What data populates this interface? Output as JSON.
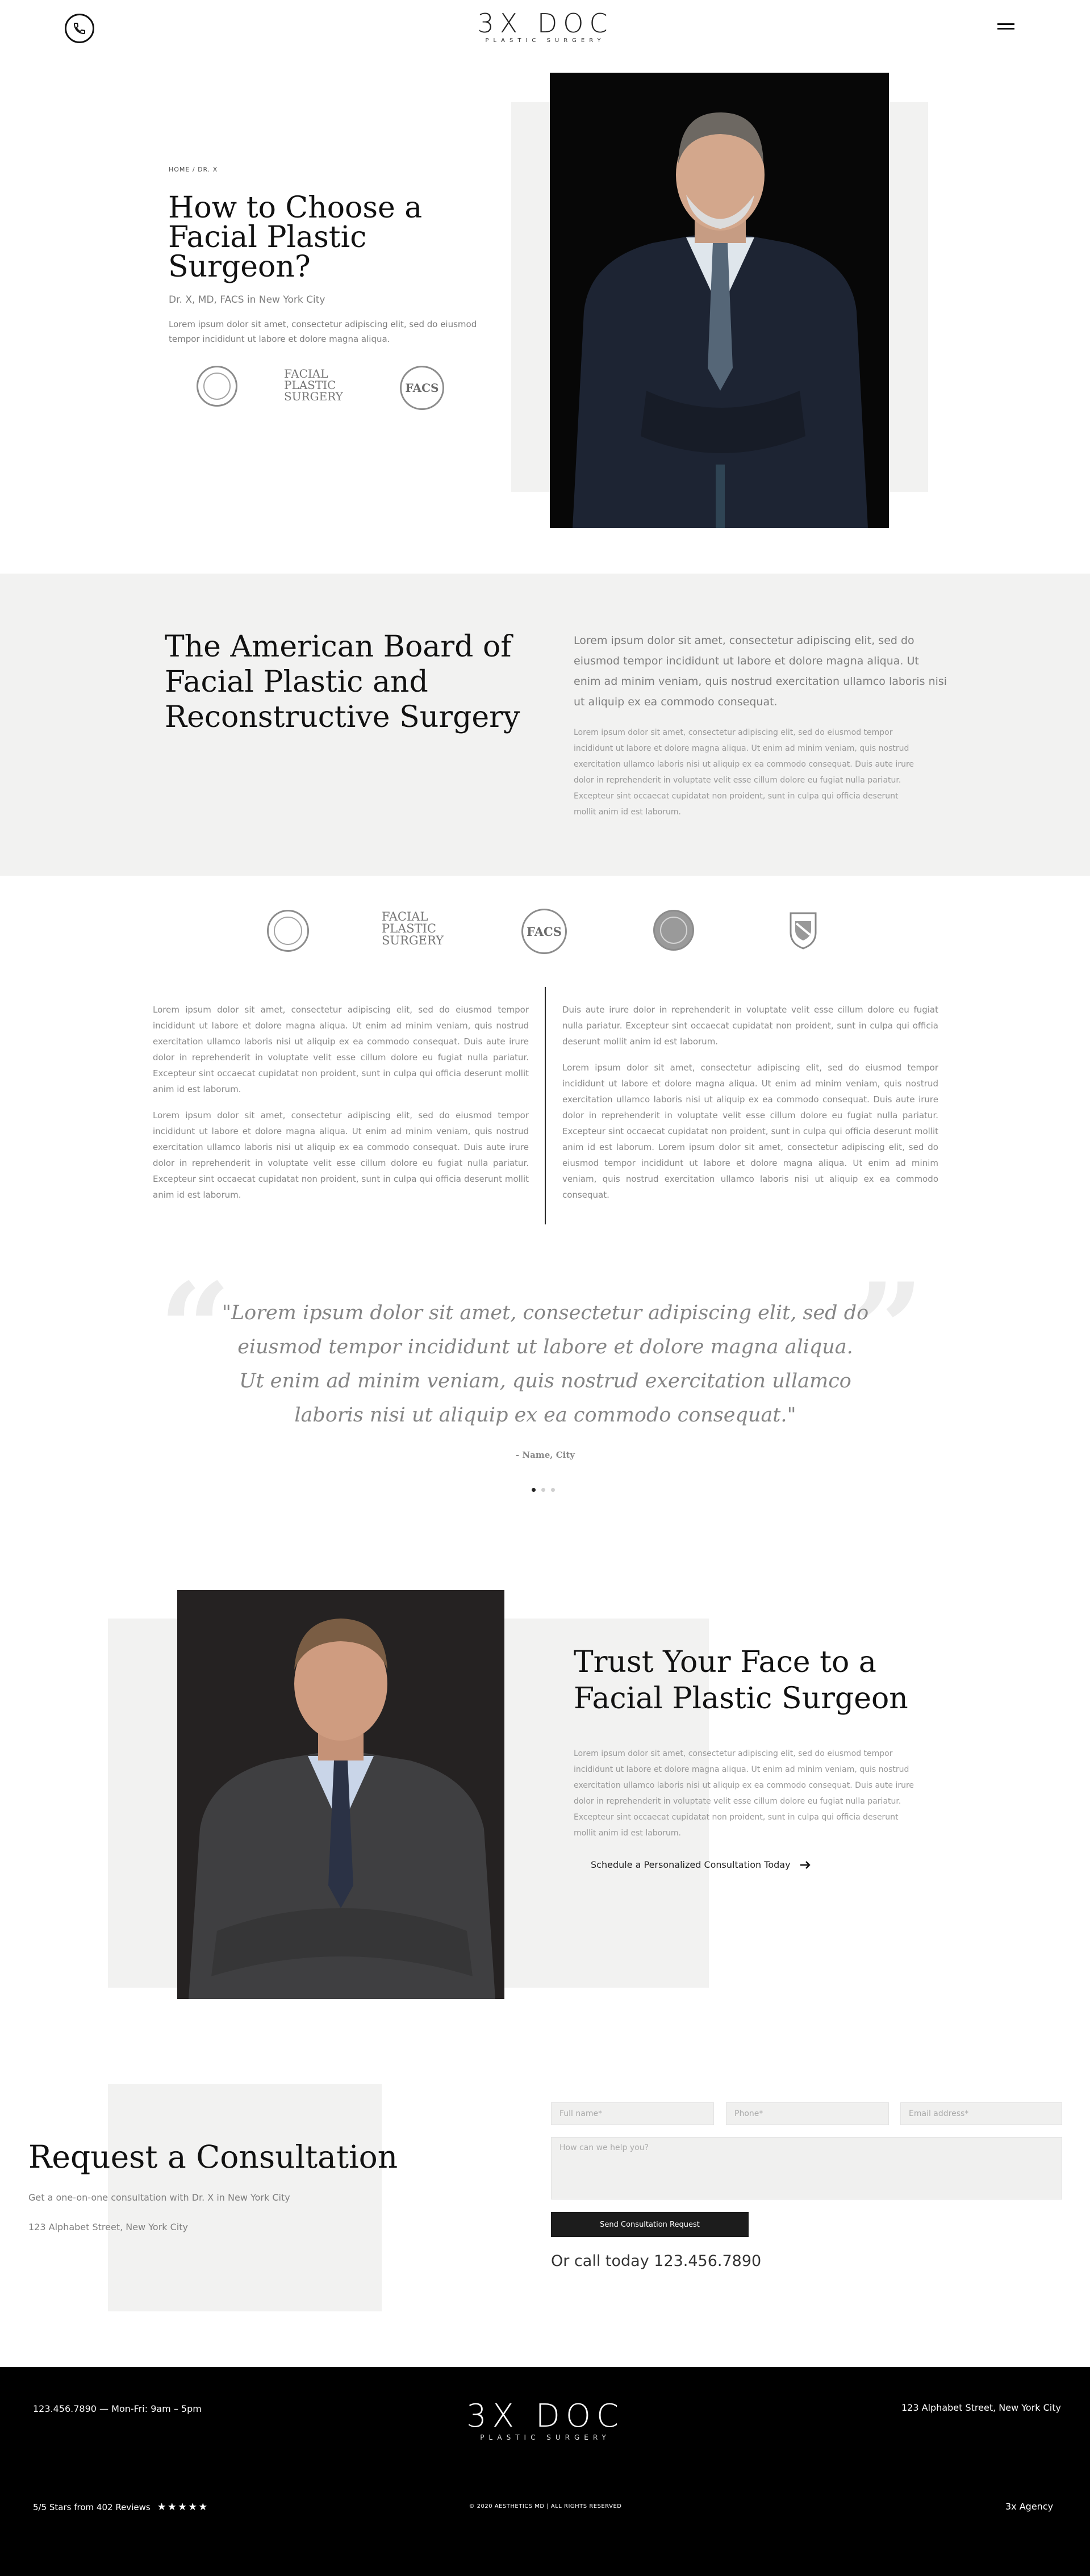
{
  "header": {
    "logo_main": "3X DOC",
    "logo_sub": "PLASTIC SURGERY",
    "icons": {
      "phone": "phone-icon",
      "menu": "hamburger-menu-icon"
    }
  },
  "hero": {
    "breadcrumb": "HOME / DR. X",
    "title_lines": [
      "How to Choose a",
      "Facial Plastic",
      "Surgeon?"
    ],
    "subtitle": "Dr. X, MD, FACS in New York City",
    "body_lines": [
      "Lorem ipsum dolor sit amet, consectetur adipiscing elit, sed do eiusmod",
      "tempor incididunt ut labore et dolore magna aliqua."
    ],
    "badges": {
      "facial_plastic_surgery": [
        "FACIAL",
        "PLASTIC",
        "SURGERY"
      ],
      "facs": "FACS"
    }
  },
  "board": {
    "title_lines": [
      "The American Board of",
      "Facial Plastic and",
      "Reconstructive Surgery"
    ],
    "lead_lines": [
      "Lorem ipsum dolor sit amet, consectetur adipiscing elit, sed do",
      "eiusmod tempor incididunt ut labore et dolore magna aliqua. Ut",
      "enim ad minim veniam, quis nostrud exercitation ullamco laboris nisi",
      "ut aliquip ex ea commodo consequat."
    ],
    "body_lines": [
      "Lorem ipsum dolor sit amet, consectetur adipiscing elit, sed do eiusmod tempor",
      "incididunt ut labore et dolore magna aliqua. Ut enim ad minim veniam, quis nostrud",
      "exercitation ullamco laboris nisi ut aliquip ex ea commodo consequat. Duis aute irure",
      "dolor in reprehenderit in voluptate velit esse cillum dolore eu fugiat nulla pariatur.",
      "Excepteur sint occaecat cupidatat non proident, sunt in culpa qui officia deserunt",
      "mollit anim id est laborum."
    ]
  },
  "logos": {
    "facial_plastic_surgery": [
      "FACIAL",
      "PLASTIC",
      "SURGERY"
    ],
    "facs": "FACS"
  },
  "columns": {
    "left": [
      "Lorem ipsum dolor sit amet, consectetur adipiscing elit, sed do eiusmod tempor incididunt ut labore et dolore magna aliqua. Ut enim ad minim veniam, quis nostrud exercitation ullamco laboris nisi ut aliquip ex ea commodo consequat. Duis aute irure dolor in reprehenderit in voluptate velit esse cillum dolore eu fugiat nulla pariatur. Excepteur sint occaecat cupidatat non proident, sunt in culpa qui officia deserunt mollit anim id est laborum.",
      "Lorem ipsum dolor sit amet, consectetur adipiscing elit, sed do eiusmod tempor incididunt ut labore et dolore magna aliqua. Ut enim ad minim veniam, quis nostrud exercitation ullamco laboris nisi ut aliquip ex ea commodo consequat. Duis aute irure dolor in reprehenderit in voluptate velit esse cillum dolore eu fugiat nulla pariatur. Excepteur sint occaecat cupidatat non proident, sunt in culpa qui officia deserunt mollit anim id est laborum."
    ],
    "right": [
      "Duis aute irure dolor in reprehenderit in voluptate velit esse cillum dolore eu fugiat nulla pariatur. Excepteur sint occaecat cupidatat non proident, sunt in culpa qui officia deserunt mollit anim id est laborum.",
      "Lorem ipsum dolor sit amet, consectetur adipiscing elit, sed do eiusmod tempor incididunt ut labore et dolore magna aliqua. Ut enim ad minim veniam, quis nostrud exercitation ullamco laboris nisi ut aliquip ex ea commodo consequat. Duis aute irure dolor in reprehenderit in voluptate velit esse cillum dolore eu fugiat nulla pariatur. Excepteur sint occaecat cupidatat non proident, sunt in culpa qui officia deserunt mollit anim id est laborum. Lorem ipsum dolor sit amet, consectetur adipiscing elit, sed do eiusmod tempor incididunt ut labore et dolore magna aliqua. Ut enim ad minim veniam, quis nostrud exercitation ullamco laboris nisi ut aliquip ex ea commodo consequat."
    ]
  },
  "testimonial": {
    "open_quote": "“",
    "close_quote": "”",
    "quote_lines": [
      "\"Lorem ipsum dolor sit amet, consectetur adipiscing elit, sed do",
      "eiusmod tempor incididunt ut labore et dolore magna aliqua.",
      "Ut enim ad minim veniam, quis nostrud exercitation ullamco",
      "laboris nisi ut aliquip ex ea commodo consequat.\""
    ],
    "author": "- Name, City",
    "slides": 3,
    "active_slide": 1
  },
  "trust": {
    "title_lines": [
      "Trust Your Face to a",
      "Facial Plastic Surgeon"
    ],
    "body_lines": [
      "Lorem ipsum dolor sit amet, consectetur adipiscing elit, sed do eiusmod tempor",
      "incididunt ut labore et dolore magna aliqua. Ut enim ad minim veniam, quis nostrud",
      "exercitation ullamco laboris nisi ut aliquip ex ea commodo consequat. Duis aute irure",
      "dolor in reprehenderit in voluptate velit esse cillum dolore eu fugiat nulla pariatur.",
      "Excepteur sint occaecat cupidatat non proident, sunt in culpa qui officia deserunt",
      "mollit anim id est laborum."
    ],
    "cta": "Schedule a Personalized Consultation Today",
    "cta_icon": "arrow-right-icon"
  },
  "consult": {
    "title": "Request a Consultation",
    "subtitle": "Get a one-on-one consultation with Dr. X in New York City",
    "address": "123 Alphabet Street, New York City",
    "placeholders": {
      "name": "Full name*",
      "phone": "Phone*",
      "email": "Email address*",
      "message": "How can we help you?"
    },
    "submit": "Send Consultation Request",
    "call_prefix": "Or call today ",
    "phone": "123.456.7890"
  },
  "footer": {
    "phone_hours": "123.456.7890 — Mon-Fri: 9am – 5pm",
    "address": "123 Alphabet Street, New York City",
    "logo_main": "3X DOC",
    "logo_sub": "PLASTIC SURGERY",
    "reviews": "5/5 Stars from 402 Reviews",
    "stars": "★★★★★",
    "copyright": "© 2020 AESTHETICS MD | ALL RIGHTS RESERVED",
    "agency": "3x Agency"
  },
  "colors": {
    "panel": "#f2f2f1",
    "dark": "#000000",
    "text_grey": "#7d7d7d",
    "button": "#1c1c1c"
  }
}
